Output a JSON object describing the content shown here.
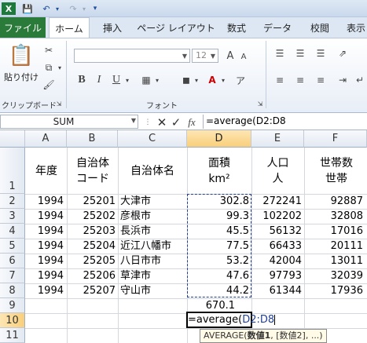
{
  "ribbon": {
    "file_tab": "ファイル",
    "tabs": [
      "ホーム",
      "挿入",
      "ページ レイアウト",
      "数式",
      "データ",
      "校閲",
      "表示"
    ],
    "paste_label": "貼り付け",
    "clipboard_label": "クリップボード",
    "font_label": "フォント",
    "font_size": "12",
    "bold": "B",
    "italic": "I",
    "underline": "U"
  },
  "formula_bar": {
    "name_box": "SUM",
    "formula": "=average(D2:D8"
  },
  "columns": [
    "A",
    "B",
    "C",
    "D",
    "E",
    "F"
  ],
  "rows": [
    "1",
    "2",
    "3",
    "4",
    "5",
    "6",
    "7",
    "8",
    "9",
    "10",
    "11"
  ],
  "header_row": {
    "a": "年度",
    "b1": "自治体",
    "b2": "コード",
    "c": "自治体名",
    "d1": "面積",
    "d2": "km²",
    "e1": "人口",
    "e2": "人",
    "f1": "世帯数",
    "f2": "世帯"
  },
  "table": [
    [
      "1994",
      "25201",
      "大津市",
      "302.8",
      "272241",
      "92887"
    ],
    [
      "1994",
      "25202",
      "彦根市",
      "99.3",
      "102202",
      "32808"
    ],
    [
      "1994",
      "25203",
      "長浜市",
      "45.5",
      "56132",
      "17016"
    ],
    [
      "1994",
      "25204",
      "近江八幡市",
      "77.5",
      "66433",
      "20111"
    ],
    [
      "1994",
      "25205",
      "八日市市",
      "53.2",
      "42004",
      "13011"
    ],
    [
      "1994",
      "25206",
      "草津市",
      "47.6",
      "97793",
      "32039"
    ],
    [
      "1994",
      "25207",
      "守山市",
      "44.2",
      "61344",
      "17936"
    ]
  ],
  "d9": "670.1",
  "edit_cell": {
    "prefix": "=average(",
    "ref": "D2:D8"
  },
  "tooltip": {
    "func": "AVERAGE(",
    "arg1": "数値1",
    "rest": ", [数値2], ...)"
  },
  "colors": {
    "file_tab": "#2a7a3a",
    "selection": "#f9cf7a",
    "marquee": "#1f3f9a"
  }
}
